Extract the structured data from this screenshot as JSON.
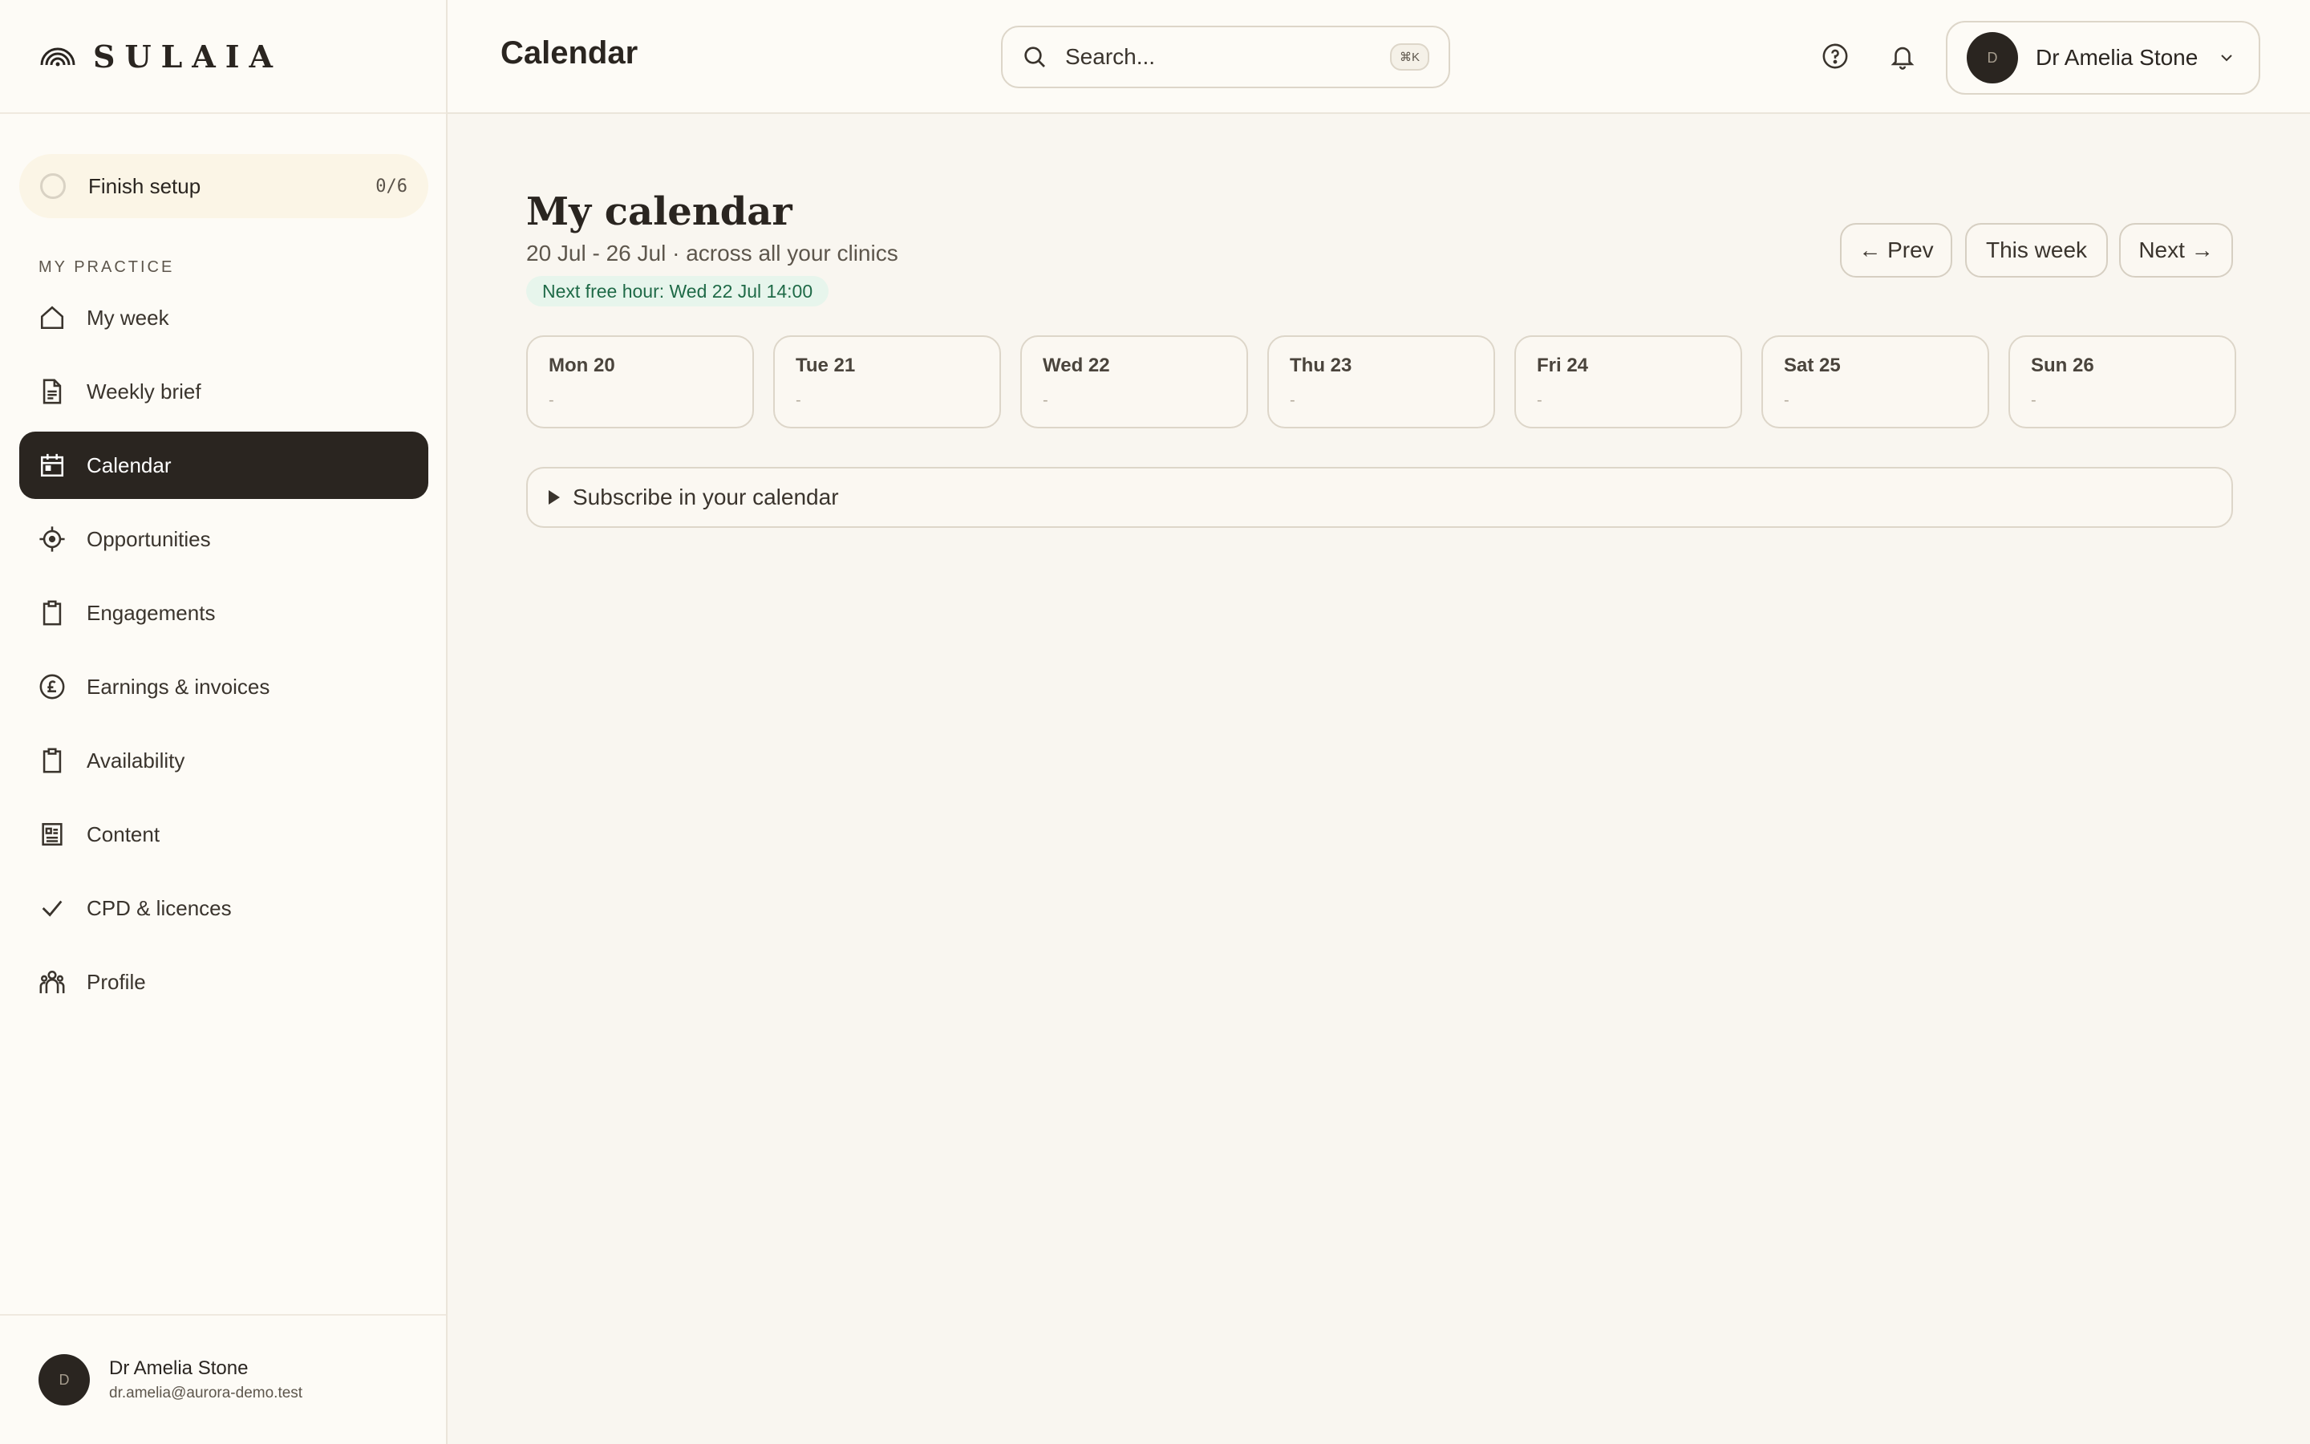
{
  "brand": {
    "name": "SULAIA"
  },
  "setup": {
    "label": "Finish setup",
    "count": "0/6"
  },
  "sidebar": {
    "section_label": "MY PRACTICE",
    "items": [
      {
        "label": "My week",
        "icon": "home-icon"
      },
      {
        "label": "Weekly brief",
        "icon": "document-icon"
      },
      {
        "label": "Calendar",
        "icon": "calendar-icon",
        "active": true
      },
      {
        "label": "Opportunities",
        "icon": "target-icon"
      },
      {
        "label": "Engagements",
        "icon": "clipboard-icon"
      },
      {
        "label": "Earnings & invoices",
        "icon": "pound-icon"
      },
      {
        "label": "Availability",
        "icon": "clipboard-icon"
      },
      {
        "label": "Content",
        "icon": "newspaper-icon"
      },
      {
        "label": "CPD & licences",
        "icon": "check-icon"
      },
      {
        "label": "Profile",
        "icon": "people-icon"
      }
    ]
  },
  "footer_user": {
    "initial": "D",
    "name": "Dr Amelia Stone",
    "email": "dr.amelia@aurora-demo.test"
  },
  "topbar": {
    "title": "Calendar",
    "search_placeholder": "Search...",
    "search_shortcut": "⌘K",
    "user_initial": "D",
    "user_name": "Dr Amelia Stone"
  },
  "main": {
    "heading": "My calendar",
    "subtitle": "20 Jul - 26 Jul · across all your clinics",
    "next_free": "Next free hour: Wed 22 Jul 14:00",
    "nav": {
      "prev": "← Prev",
      "this_week": "This week",
      "next": "Next →"
    },
    "days": [
      {
        "name": "Mon 20",
        "value": "-"
      },
      {
        "name": "Tue 21",
        "value": "-"
      },
      {
        "name": "Wed 22",
        "value": "-"
      },
      {
        "name": "Thu 23",
        "value": "-"
      },
      {
        "name": "Fri 24",
        "value": "-"
      },
      {
        "name": "Sat 25",
        "value": "-"
      },
      {
        "name": "Sun 26",
        "value": "-"
      }
    ],
    "subscribe_label": "Subscribe in your calendar"
  },
  "colors": {
    "accent_dark": "#2a2520",
    "badge_bg": "#e7f5ec",
    "badge_text": "#1f6a47",
    "background": "#f9f6f0"
  }
}
